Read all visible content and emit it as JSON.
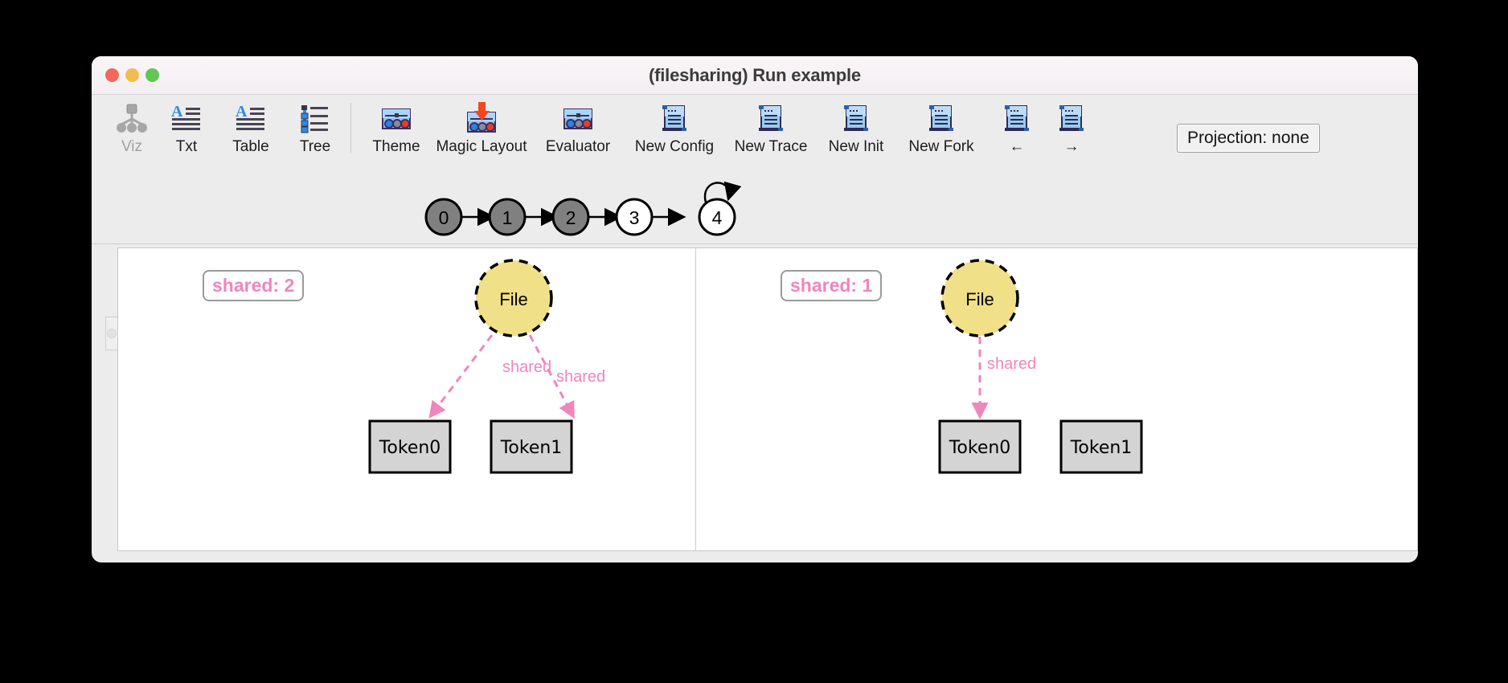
{
  "window": {
    "title": "(filesharing) Run example",
    "traffic_lights": [
      "close",
      "minimize",
      "maximize"
    ]
  },
  "toolbar": {
    "groups": [
      {
        "items": [
          {
            "label": "Viz",
            "icon": "graph-tree-icon",
            "disabled": true
          },
          {
            "label": "Txt",
            "icon": "text-document-icon",
            "disabled": false
          },
          {
            "label": "Table",
            "icon": "text-document-icon",
            "disabled": false
          },
          {
            "label": "Tree",
            "icon": "tree-list-icon",
            "disabled": false
          }
        ]
      },
      {
        "items": [
          {
            "label": "Theme",
            "icon": "sliders-panel-icon",
            "disabled": false
          },
          {
            "label": "Magic Layout",
            "icon": "sliders-panel-arrow-icon",
            "disabled": false
          },
          {
            "label": "Evaluator",
            "icon": "sliders-panel-icon",
            "disabled": false
          },
          {
            "label": "New Config",
            "icon": "scroll-document-icon",
            "disabled": false
          },
          {
            "label": "New Trace",
            "icon": "scroll-document-icon",
            "disabled": false
          },
          {
            "label": "New Init",
            "icon": "scroll-document-icon",
            "disabled": false
          },
          {
            "label": "New Fork",
            "icon": "scroll-document-icon",
            "disabled": false
          },
          {
            "label": "←",
            "icon": "scroll-document-icon",
            "disabled": false
          },
          {
            "label": "→",
            "icon": "scroll-document-icon",
            "disabled": false
          }
        ]
      }
    ],
    "projection_label": "Projection: none"
  },
  "trace": {
    "states": [
      {
        "id": "0",
        "label": "0",
        "selected": true
      },
      {
        "id": "1",
        "label": "1",
        "selected": true
      },
      {
        "id": "2",
        "label": "2",
        "selected": true
      },
      {
        "id": "3",
        "label": "3",
        "selected": false
      },
      {
        "id": "4",
        "label": "4",
        "selected": false
      }
    ],
    "self_loop_on": "4",
    "selected_fill": "#808080",
    "unselected_fill": "#ffffff"
  },
  "diagrams": {
    "accent_pink": "#ef86bd",
    "node_yellow": "#f0e088",
    "box_gray": "#d4d4d4",
    "left": {
      "badge": "shared: 2",
      "file_node": {
        "label": "File",
        "shape": "circle",
        "fill": "#f0e088",
        "border": "dashed"
      },
      "boxes": [
        {
          "label": "Token0"
        },
        {
          "label": "Token1"
        }
      ],
      "edges": [
        {
          "from": "File",
          "to": "Token0",
          "label": "shared"
        },
        {
          "from": "File",
          "to": "Token1",
          "label": "shared"
        }
      ]
    },
    "right": {
      "badge": "shared: 1",
      "file_node": {
        "label": "File",
        "shape": "circle",
        "fill": "#f0e088",
        "border": "dashed"
      },
      "boxes": [
        {
          "label": "Token0"
        },
        {
          "label": "Token1"
        }
      ],
      "edges": [
        {
          "from": "File",
          "to": "Token0",
          "label": "shared"
        }
      ]
    }
  }
}
